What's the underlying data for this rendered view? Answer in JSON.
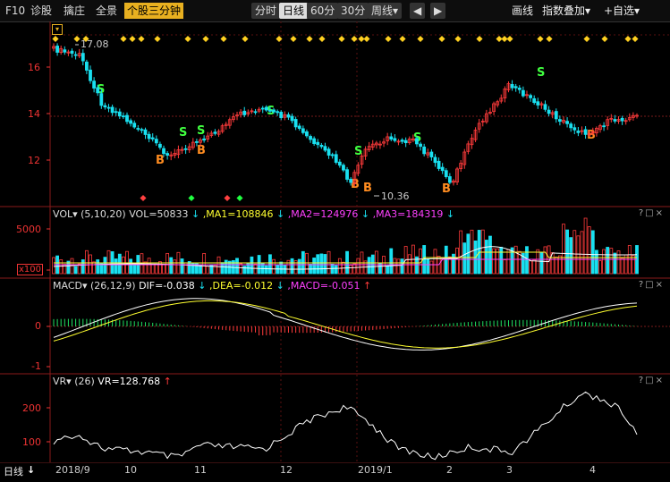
{
  "toolbar": {
    "left_items": [
      "F10",
      "诊股",
      "擒庄",
      "全景",
      "个股三分钟"
    ],
    "active_left": "个股三分钟",
    "periods": [
      "分时",
      "日线",
      "60分",
      "30分",
      "周线▾",
      "◀",
      "▶"
    ],
    "active_period": "日线",
    "right_items": [
      "画线",
      "指数叠加▾",
      "+自选▾"
    ]
  },
  "price_panel": {
    "high_label": "17.08",
    "low_label": "10.36",
    "y_ticks": [
      "16",
      "14",
      "12"
    ]
  },
  "vol_panel": {
    "name": "VOL▾",
    "params": "(5,10,20)",
    "vol": "VOL=50833",
    "ma1": ",MA1=108846",
    "ma2": ",MA2=124976",
    "ma3": ",MA3=184319",
    "y_ticks": [
      "5000",
      "x100"
    ]
  },
  "macd_panel": {
    "name": "MACD▾",
    "params": "(26,12,9)",
    "dif": "DIF=-0.038",
    "dea": ",DEA=-0.012",
    "macd": ",MACD=-0.051",
    "y_ticks": [
      "0",
      "-1"
    ]
  },
  "vr_panel": {
    "name": "VR▾",
    "params": "(26)",
    "vr": "VR=128.768",
    "y_ticks": [
      "200",
      "100"
    ]
  },
  "xaxis": {
    "period_label": "日线",
    "labels": [
      "2018/9",
      "10",
      "11",
      "12",
      "2019/1",
      "2",
      "3",
      "4"
    ]
  },
  "panel_controls": "?□×",
  "colors": {
    "up": "#ff3b3b",
    "down": "#19e0f0",
    "ma1": "#ffffff",
    "ma2": "#ffff30",
    "ma3": "#ff40ff",
    "accent": "#e8b020"
  }
}
